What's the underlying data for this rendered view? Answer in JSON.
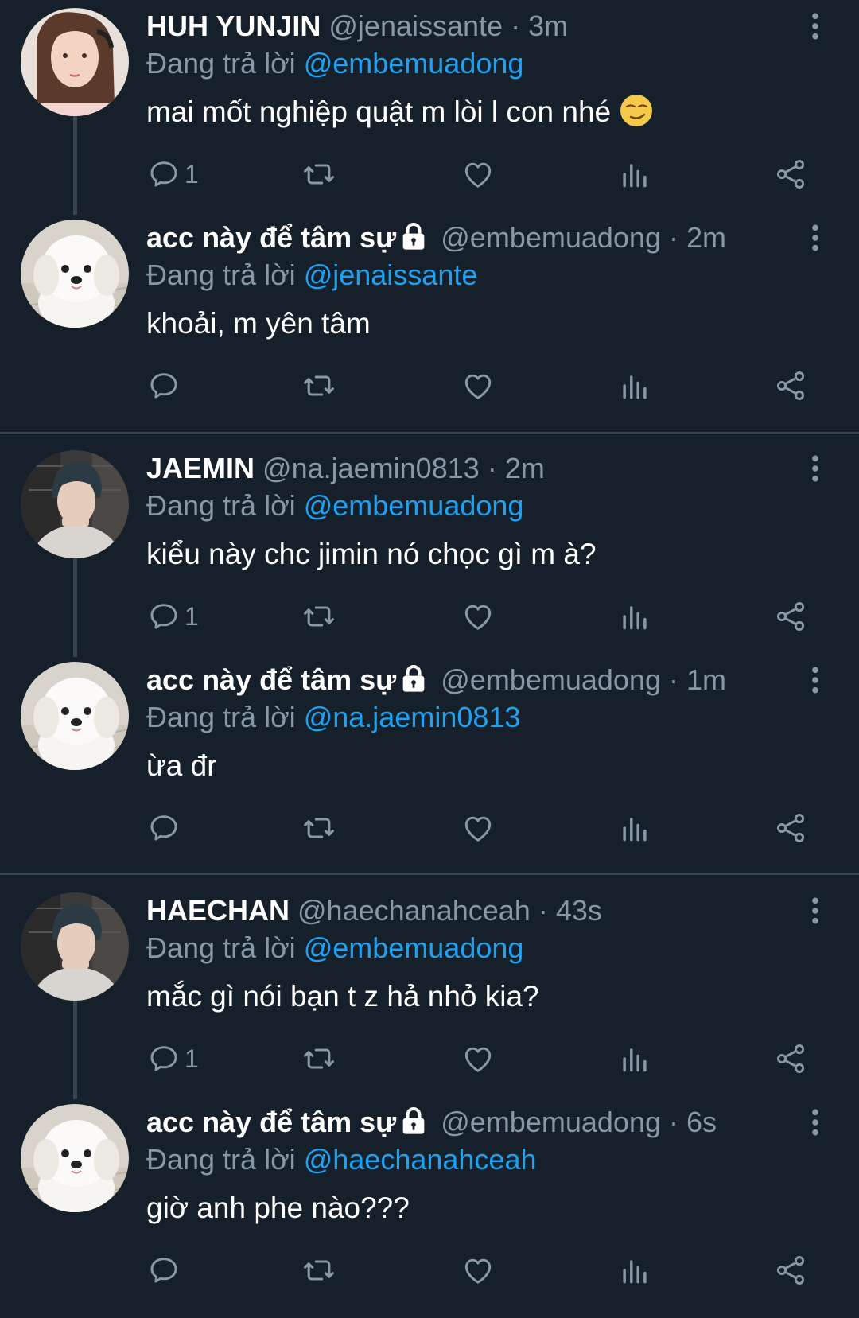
{
  "reply_prefix": "Đang trả lời",
  "colors": {
    "background": "#15202b",
    "muted": "#8899a6",
    "accent": "#1da1f2",
    "separator": "#38444d"
  },
  "tweets": [
    {
      "display_name": "HUH YUNJIN",
      "locked": false,
      "handle": "@jenaissante",
      "time": "3m",
      "reply_to": "@embemuadong",
      "text": "mai mốt nghiệp quật m lòi l con nhé",
      "emoji": "smirking-face-icon",
      "reply_count": "1",
      "avatar": "woman-portrait-avatar"
    },
    {
      "display_name": "acc này để tâm sự",
      "locked": true,
      "handle": "@embemuadong",
      "time": "2m",
      "reply_to": "@jenaissante",
      "text": "khoải, m yên tâm",
      "reply_count": "",
      "avatar": "white-dog-avatar"
    },
    {
      "display_name": "JAEMIN",
      "locked": false,
      "handle": "@na.jaemin0813",
      "time": "2m",
      "reply_to": "@embemuadong",
      "text": "kiểu này chc jimin nó chọc gì m à?",
      "reply_count": "1",
      "avatar": "man-portrait-avatar"
    },
    {
      "display_name": "acc này để tâm sự",
      "locked": true,
      "handle": "@embemuadong",
      "time": "1m",
      "reply_to": "@na.jaemin0813",
      "text": "ừa đr",
      "reply_count": "",
      "avatar": "white-dog-avatar"
    },
    {
      "display_name": "HAECHAN",
      "locked": false,
      "handle": "@haechanahceah",
      "time": "43s",
      "reply_to": "@embemuadong",
      "text": "mắc gì nói bạn t z hả nhỏ kia?",
      "reply_count": "1",
      "avatar": "man-portrait-avatar"
    },
    {
      "display_name": "acc này để tâm sự",
      "locked": true,
      "handle": "@embemuadong",
      "time": "6s",
      "reply_to": "@haechanahceah",
      "text": "giờ anh phe nào???",
      "reply_count": "",
      "avatar": "white-dog-avatar"
    }
  ]
}
